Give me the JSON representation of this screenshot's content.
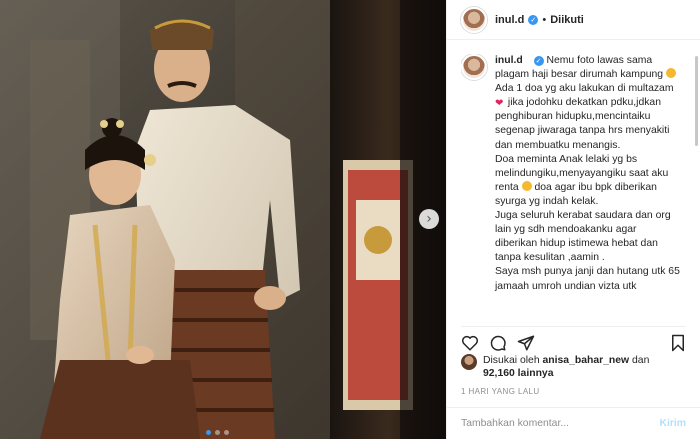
{
  "post": {
    "username": "inul.d",
    "verified_symbol": "✓",
    "separator": "•",
    "follow_status": "Diikuti"
  },
  "caption": {
    "username": "inul.d",
    "lines": [
      "Nemu foto lawas sama plagam haji besar dirumah kampung",
      "Ada 1 doa yg aku lakukan di multazam",
      "jika jodohku dekatkan pdku,jdkan penghiburan hidupku,mencintaiku segenap jiwaraga tanpa hrs menyakiti dan membuatku menangis.",
      "Doa meminta Anak lelaki yg bs melindungiku,menyayangiku saat aku renta",
      "doa agar ibu bpk diberikan syurga yg indah kelak.",
      "Juga seluruh kerabat saudara dan org lain yg sdh mendoakanku agar diberikan hidup istimewa hebat dan tanpa kesulitan ,aamin .",
      "Saya msh punya janji dan hutang utk 65 jamaah umroh undian vizta utk"
    ],
    "heart_emoji": "❤"
  },
  "likes": {
    "prefix": "Disukai oleh",
    "user": "anisa_bahar_new",
    "connector": "dan",
    "count": "92,160",
    "suffix": "lainnya"
  },
  "time": "1 HARI YANG LALU",
  "comment": {
    "placeholder": "Tambahkan komentar...",
    "post_label": "Kirim"
  },
  "carousel": {
    "next_symbol": "›",
    "slides": 3,
    "active": 0
  },
  "colors": {
    "accent": "#3897f0",
    "heart": "#e0245e",
    "border": "#efefef",
    "muted": "#8e8e8e"
  }
}
